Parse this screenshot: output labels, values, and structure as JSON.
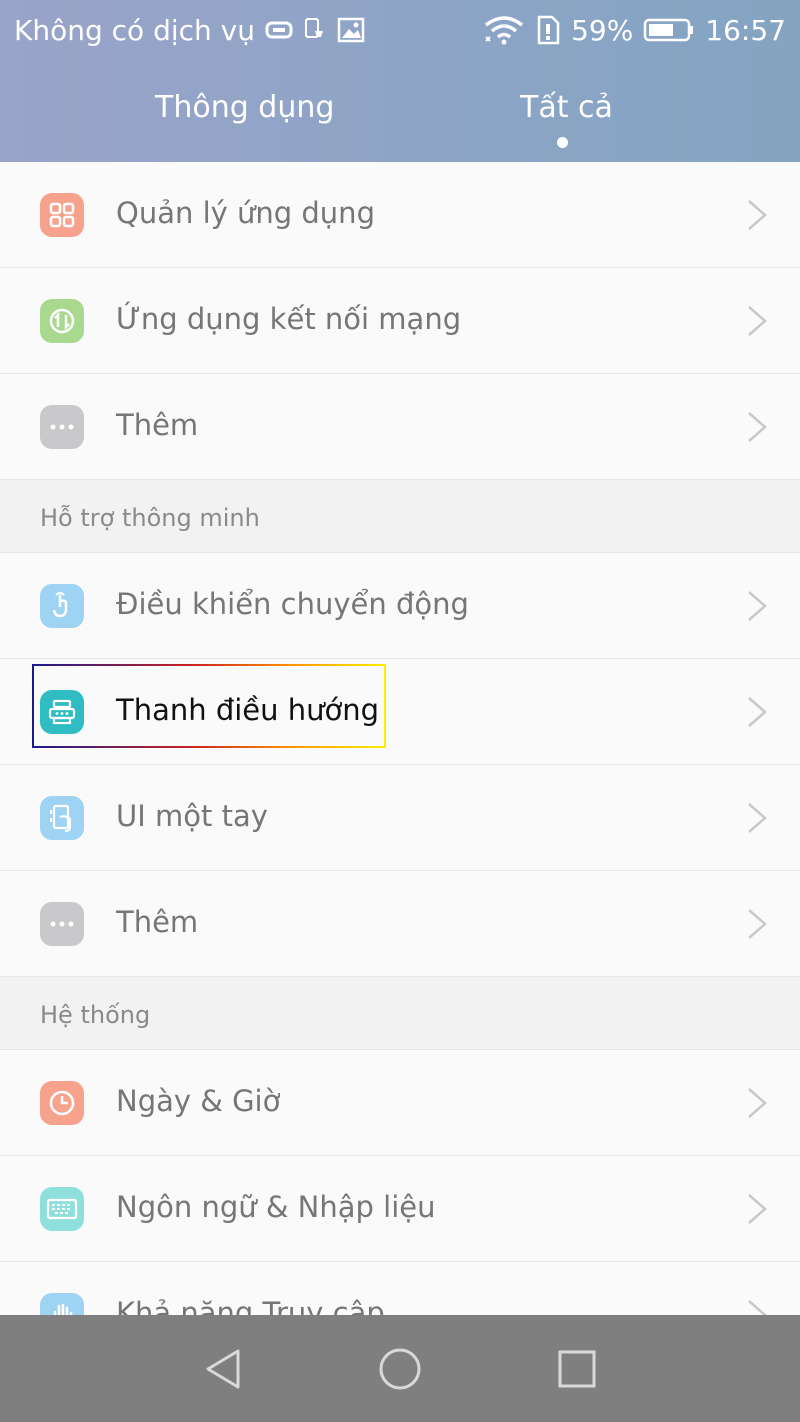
{
  "status_bar": {
    "carrier": "Không có dịch vụ",
    "battery_percent": "59%",
    "time": "16:57",
    "icons": [
      "message-icon",
      "notification-icon",
      "image-icon",
      "wifi-icon",
      "sim-alert-icon",
      "battery-icon"
    ]
  },
  "tabs": [
    {
      "label": "Thông dụng",
      "active": false
    },
    {
      "label": "Tất cả",
      "active": true
    }
  ],
  "list": {
    "group1": [
      {
        "label": "Quản lý ứng dụng",
        "icon": "apps-grid-icon",
        "color": "#f7a28c"
      },
      {
        "label": "Ứng dụng kết nối mạng",
        "icon": "network-apps-icon",
        "color": "#a8d98f"
      },
      {
        "label": "Thêm",
        "icon": "more-dots-icon",
        "color": "#c9c9cc"
      }
    ],
    "section_smart": "Hỗ trợ thông minh",
    "group2": [
      {
        "label": "Điều khiển chuyển động",
        "icon": "motion-gesture-icon",
        "color": "#9fd3f3"
      },
      {
        "label": "Thanh điều hướng",
        "icon": "navigation-bar-icon",
        "color": "#2fbcc3",
        "highlighted": true
      },
      {
        "label": "UI một tay",
        "icon": "one-hand-ui-icon",
        "color": "#9fd3f3"
      },
      {
        "label": "Thêm",
        "icon": "more-dots-icon",
        "color": "#c9c9cc"
      }
    ],
    "section_system": "Hệ thống",
    "group3": [
      {
        "label": "Ngày & Giờ",
        "icon": "clock-icon",
        "color": "#f7a28c"
      },
      {
        "label": "Ngôn ngữ & Nhập liệu",
        "icon": "keyboard-icon",
        "color": "#8fe0dc"
      },
      {
        "label": "Khả năng Truy cập",
        "icon": "accessibility-hand-icon",
        "color": "#9fd3f3"
      }
    ]
  },
  "navbar": [
    "back-button",
    "home-button",
    "recent-apps-button"
  ]
}
